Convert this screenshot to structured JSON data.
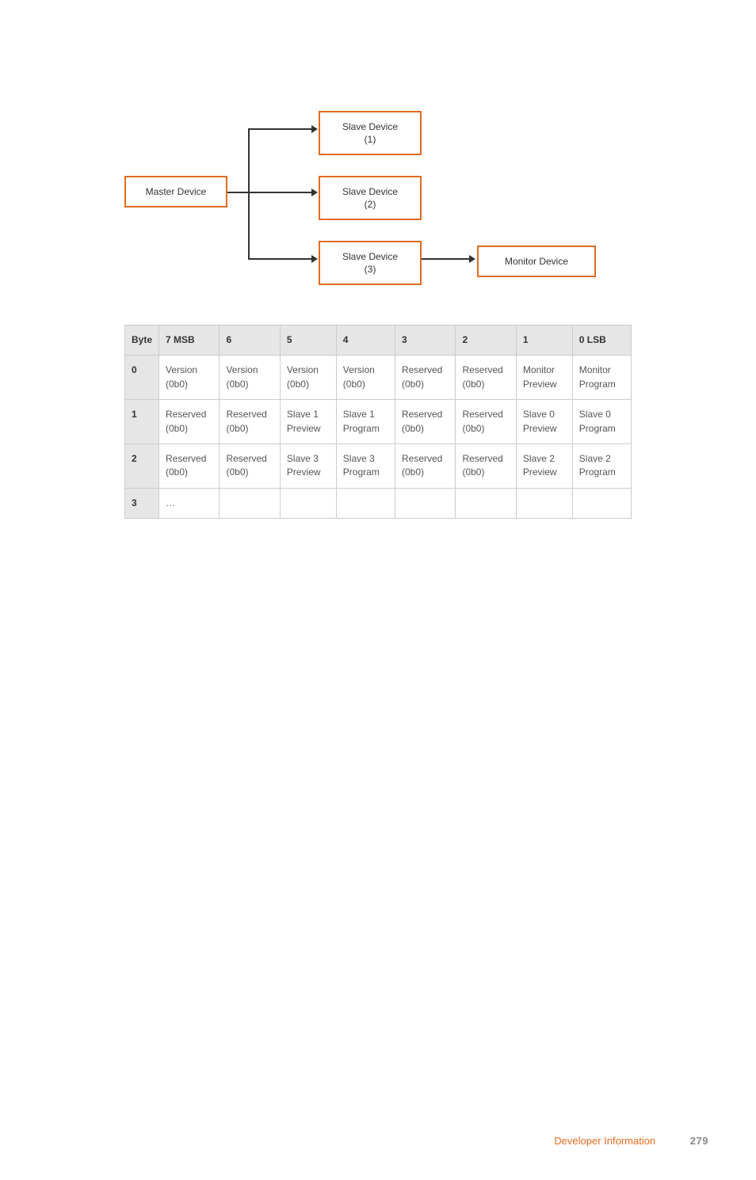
{
  "diagram": {
    "master": "Master Device",
    "slave1": "Slave Device\n(1)",
    "slave2": "Slave Device\n(2)",
    "slave3": "Slave Device\n(3)",
    "monitor": "Monitor Device"
  },
  "table": {
    "headers": [
      "Byte",
      "7 MSB",
      "6",
      "5",
      "4",
      "3",
      "2",
      "1",
      "0 LSB"
    ],
    "rows": [
      {
        "byte": "0",
        "cells": [
          "Version (0b0)",
          "Version (0b0)",
          "Version (0b0)",
          "Version (0b0)",
          "Reserved (0b0)",
          "Reserved (0b0)",
          "Monitor Preview",
          "Monitor Program"
        ]
      },
      {
        "byte": "1",
        "cells": [
          "Reserved (0b0)",
          "Reserved (0b0)",
          "Slave 1 Preview",
          "Slave 1 Program",
          "Reserved (0b0)",
          "Reserved (0b0)",
          "Slave 0 Preview",
          "Slave 0 Program"
        ]
      },
      {
        "byte": "2",
        "cells": [
          "Reserved (0b0)",
          "Reserved (0b0)",
          "Slave 3 Preview",
          "Slave 3 Program",
          "Reserved (0b0)",
          "Reserved (0b0)",
          "Slave 2 Preview",
          "Slave 2 Program"
        ]
      },
      {
        "byte": "3",
        "cells": [
          "…",
          "",
          "",
          "",
          "",
          "",
          "",
          ""
        ]
      }
    ]
  },
  "footer": {
    "section": "Developer Information",
    "page": "279"
  }
}
